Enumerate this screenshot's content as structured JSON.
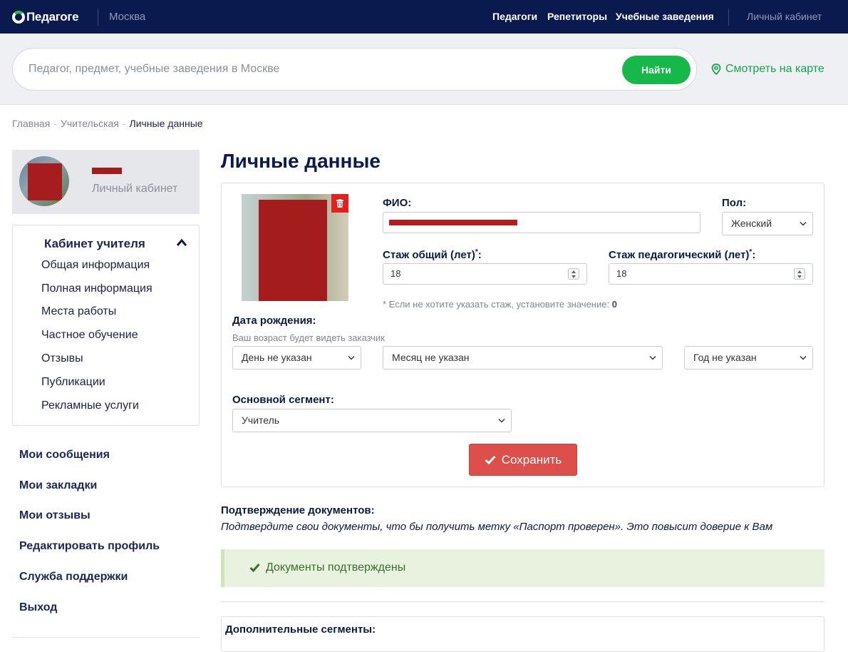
{
  "header": {
    "logo": "Педагоге",
    "city": "Москва",
    "nav": [
      "Педагоги",
      "Репетиторы",
      "Учебные заведения"
    ],
    "cabinet": "Личный кабинет"
  },
  "search": {
    "placeholder": "Педагог, предмет, учебные заведения в Москве",
    "button": "Найти",
    "map_link": "Смотреть на карте"
  },
  "breadcrumb": {
    "items": [
      "Главная",
      "Учительская"
    ],
    "current": "Личные данные"
  },
  "sidebar": {
    "profile_label": "Личный кабинет",
    "menu_title": "Кабинет учителя",
    "menu_items": [
      "Общая информация",
      "Полная информация",
      "Места работы",
      "Частное обучение",
      "Отзывы",
      "Публикации",
      "Рекламные услуги"
    ],
    "links": [
      "Мои сообщения",
      "Мои закладки",
      "Мои отзывы",
      "Редактировать профиль",
      "Служба поддержки",
      "Выход"
    ]
  },
  "main": {
    "title": "Личные данные",
    "form": {
      "fio_label": "ФИО:",
      "gender_label": "Пол:",
      "gender_value": "Женский",
      "exp_total_label": "Стаж общий (лет)",
      "exp_total_value": "18",
      "exp_ped_label": "Стаж педагогический (лет)",
      "exp_ped_value": "18",
      "required_mark": "*",
      "exp_hint": "* Если не хотите указать стаж, установите значение:",
      "exp_hint_value": "0",
      "birth_label": "Дата рождения:",
      "birth_hint": "Ваш возраст будет видеть заказчик",
      "day_value": "День не указан",
      "month_value": "Месяц не указан",
      "year_value": "Год не указан",
      "segment_label": "Основной сегмент:",
      "segment_value": "Учитель",
      "save_button": "Сохранить"
    },
    "docs": {
      "title": "Подтверждение документов:",
      "text": "Подтвердите свои документы, что бы получить метку «Паспорт проверен». Это повысит доверие к Вам",
      "status": "Документы подтверждены"
    },
    "segments_title": "Дополнительные сегменты:"
  },
  "colors": {
    "header_bg": "#0b1a4e",
    "accent_green": "#16b84a",
    "save_red": "#dd4f4a",
    "alert_bg": "#e8f2df"
  }
}
